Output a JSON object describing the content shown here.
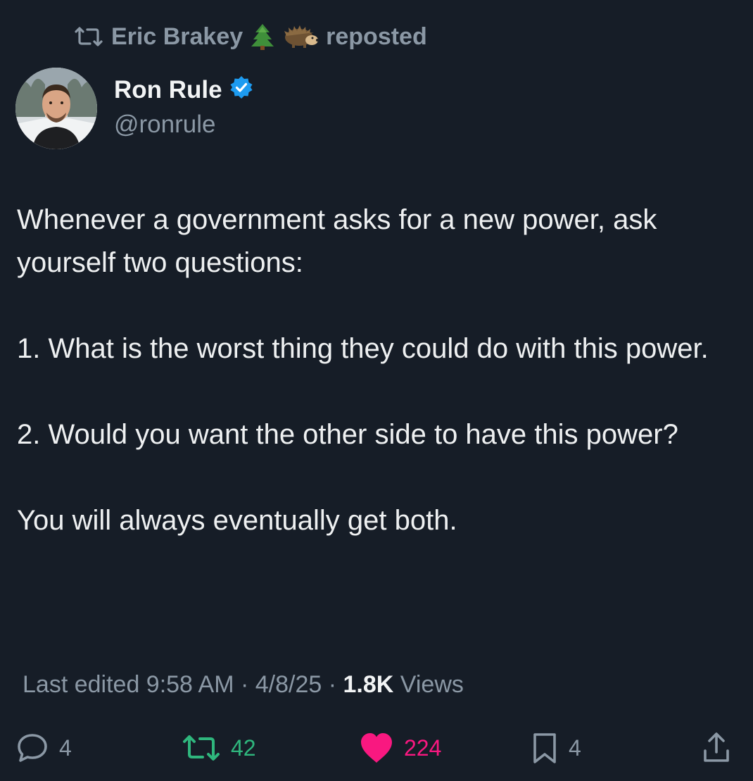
{
  "repost": {
    "user": "Eric Brakey",
    "emoji_tree": "🌲",
    "emoji_hedgehog": "🦔",
    "label": "reposted",
    "icon": "repost-icon"
  },
  "author": {
    "name": "Ron Rule",
    "handle": "@ronrule",
    "verified_icon": "verified-badge-icon",
    "avatar_icon": "avatar-photo"
  },
  "tweet": {
    "paragraphs": [
      "Whenever a government asks for a new power, ask yourself two questions:",
      "1. What is the worst thing they could do with this power.",
      "2. Would you want the other side to have this power?",
      "You will always eventually get both."
    ]
  },
  "meta": {
    "edited_label": "Last edited 9:58 AM · 4/8/25",
    "separator": " · ",
    "views_count": "1.8K",
    "views_label": " Views"
  },
  "actions": {
    "reply_count": "4",
    "repost_count": "42",
    "like_count": "224",
    "bookmark_count": "4"
  },
  "colors": {
    "background": "#161d27",
    "text": "#eef0f1",
    "muted": "#8b98a5",
    "repost_green": "#2fb67d",
    "like_pink": "#f91880",
    "verified_blue": "#1d9bf0"
  }
}
